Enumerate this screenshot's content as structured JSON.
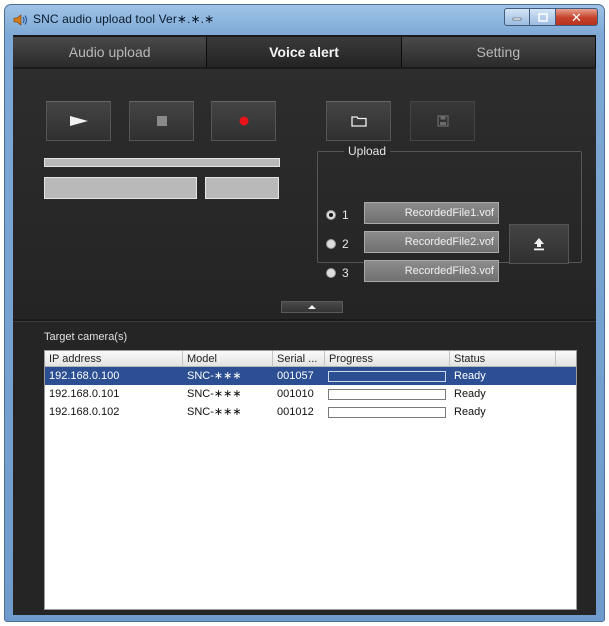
{
  "window": {
    "title": "SNC audio upload tool Ver∗.∗.∗",
    "minimize_icon": "minimize-icon",
    "maximize_icon": "maximize-icon",
    "close_icon": "close-icon"
  },
  "tabs": [
    {
      "label": "Audio upload",
      "active": false
    },
    {
      "label": "Voice alert",
      "active": true
    },
    {
      "label": "Setting",
      "active": false
    }
  ],
  "controls": {
    "play_icon": "play-icon",
    "stop_icon": "stop-icon",
    "record_icon": "record-icon",
    "open_icon": "folder-icon",
    "save_icon": "save-icon",
    "record_color": "#e8141a"
  },
  "upload": {
    "label": "Upload",
    "slots": [
      {
        "number": "1",
        "file": "RecordedFile1.vof",
        "selected": true
      },
      {
        "number": "2",
        "file": "RecordedFile2.vof",
        "selected": false
      },
      {
        "number": "3",
        "file": "RecordedFile3.vof",
        "selected": false
      }
    ],
    "upload_icon": "upload-arrow-icon",
    "collapse_icon": "chevron-up-icon"
  },
  "targets": {
    "label": "Target camera(s)",
    "columns": [
      "IP address",
      "Model",
      "Serial ...",
      "Progress",
      "Status"
    ],
    "rows": [
      {
        "ip": "192.168.0.100",
        "model": "SNC-∗∗∗",
        "serial": "001057",
        "progress": 0,
        "status": "Ready",
        "selected": true
      },
      {
        "ip": "192.168.0.101",
        "model": "SNC-∗∗∗",
        "serial": "001010",
        "progress": 0,
        "status": "Ready",
        "selected": false
      },
      {
        "ip": "192.168.0.102",
        "model": "SNC-∗∗∗",
        "serial": "001012",
        "progress": 0,
        "status": "Ready",
        "selected": false
      }
    ]
  }
}
